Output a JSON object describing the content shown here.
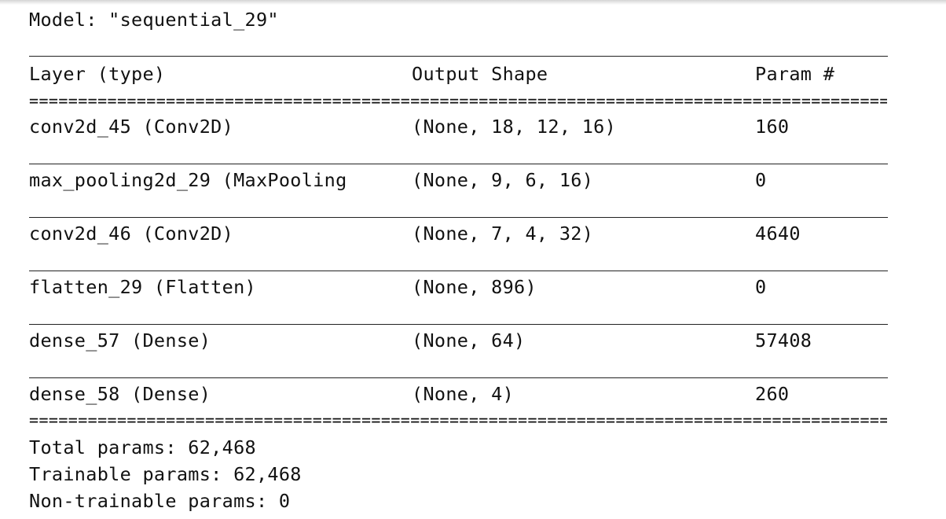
{
  "model": {
    "title": "Model: \"sequential_29\""
  },
  "header": {
    "layer": "Layer (type)",
    "output_shape": "Output Shape",
    "params": "Param #"
  },
  "separator": "====================================================================================================",
  "layers": [
    {
      "name": "conv2d_45 (Conv2D)",
      "output_shape": "(None, 18, 12, 16)",
      "params": "160"
    },
    {
      "name": "max_pooling2d_29 (MaxPooling",
      "output_shape": "(None, 9, 6, 16)",
      "params": "0"
    },
    {
      "name": "conv2d_46 (Conv2D)",
      "output_shape": "(None, 7, 4, 32)",
      "params": "4640"
    },
    {
      "name": "flatten_29 (Flatten)",
      "output_shape": "(None, 896)",
      "params": "0"
    },
    {
      "name": "dense_57 (Dense)",
      "output_shape": "(None, 64)",
      "params": "57408"
    },
    {
      "name": "dense_58 (Dense)",
      "output_shape": "(None, 4)",
      "params": "260"
    }
  ],
  "totals": {
    "total": "Total params: 62,468",
    "trainable": "Trainable params: 62,468",
    "non_trainable": "Non-trainable params: 0"
  }
}
